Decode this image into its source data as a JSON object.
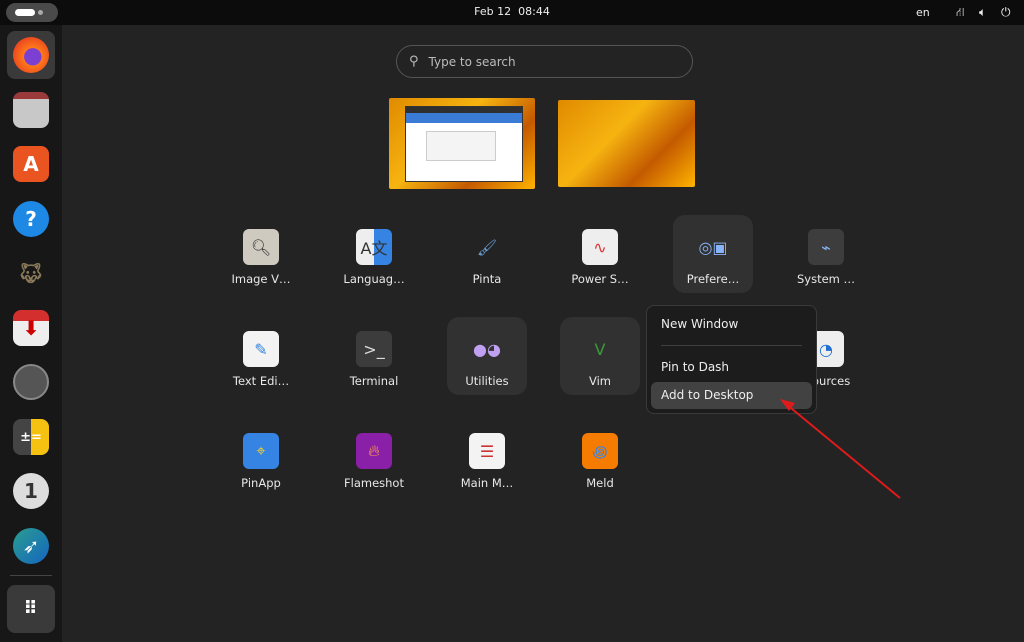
{
  "topbar": {
    "date": "Feb 12",
    "time": "08:44",
    "lang": "en",
    "icons": [
      "network-icon",
      "volume-icon",
      "power-icon"
    ]
  },
  "dock": [
    "firefox",
    "files",
    "app-center",
    "help",
    "gimp",
    "transmission",
    "clock",
    "calculator",
    "password-manager",
    "screenshot-tool",
    "show-apps"
  ],
  "search": {
    "placeholder": "Type to search"
  },
  "apps": [
    {
      "label": "Image V…",
      "icon": "image-viewer-icon"
    },
    {
      "label": "Languag…",
      "icon": "language-icon"
    },
    {
      "label": "Pinta",
      "icon": "pinta-icon"
    },
    {
      "label": "Power S…",
      "icon": "power-statistics-icon"
    },
    {
      "label": "Prefere…",
      "icon": "preferences-folder-icon"
    },
    {
      "label": "System …",
      "icon": "system-monitor-icon"
    },
    {
      "label": "Text Edi…",
      "icon": "text-editor-icon"
    },
    {
      "label": "Terminal",
      "icon": "terminal-icon"
    },
    {
      "label": "Utilities",
      "icon": "utilities-folder-icon"
    },
    {
      "label": "Vim",
      "icon": "vim-icon"
    },
    {
      "label": "sources",
      "icon": "resources-icon"
    },
    {
      "label": "PinApp",
      "icon": "pinapp-icon"
    },
    {
      "label": "Flameshot",
      "icon": "flameshot-icon"
    },
    {
      "label": "Main M…",
      "icon": "main-menu-icon"
    },
    {
      "label": "Meld",
      "icon": "meld-icon"
    }
  ],
  "context_menu": {
    "items": [
      "New Window",
      "Pin to Dash",
      "Add to Desktop"
    ],
    "selected": "Add to Desktop"
  },
  "colors": {
    "annotation_arrow": "#e01b1b"
  }
}
